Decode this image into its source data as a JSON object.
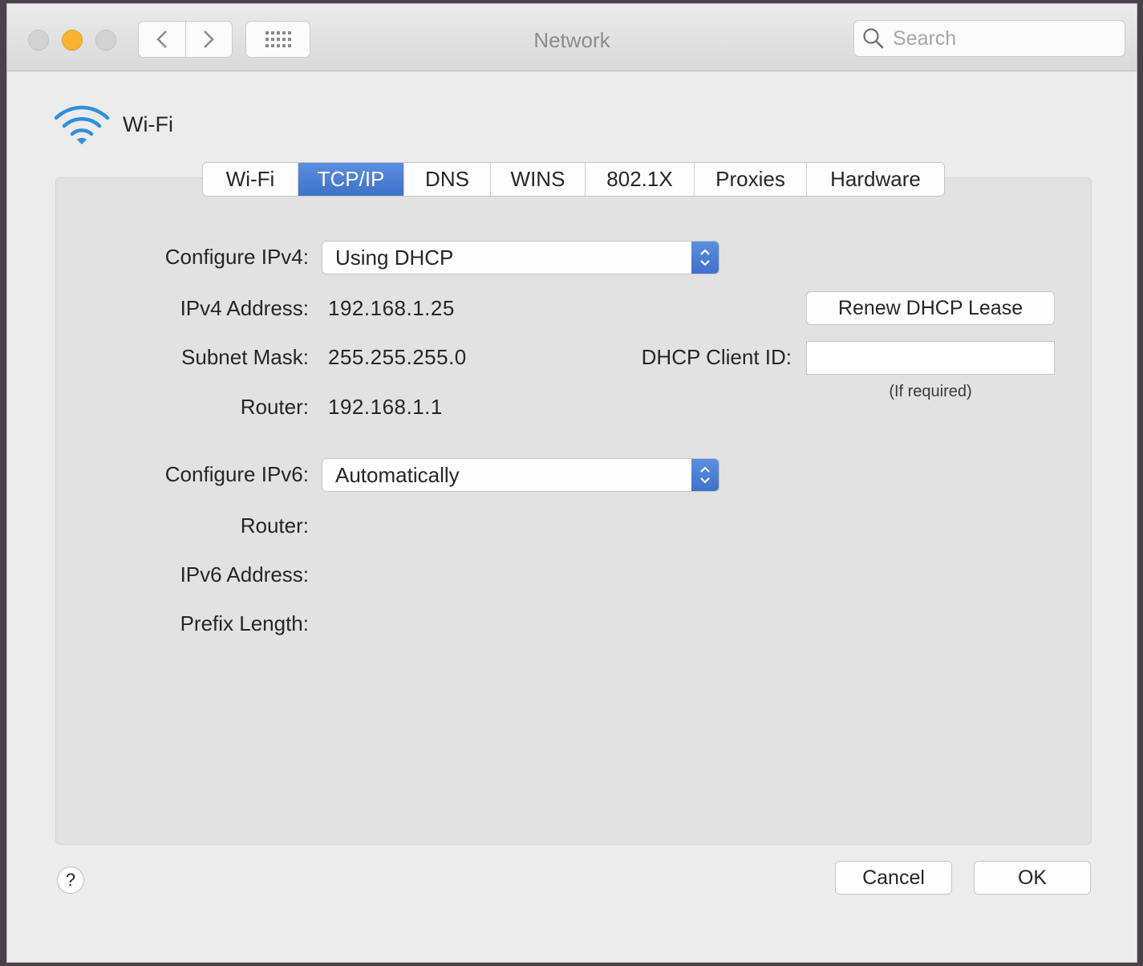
{
  "window": {
    "title": "Network"
  },
  "search": {
    "placeholder": "Search"
  },
  "interface": {
    "name": "Wi-Fi",
    "icon": "wifi-icon"
  },
  "tabs": [
    {
      "label": "Wi-Fi",
      "active": false
    },
    {
      "label": "TCP/IP",
      "active": true
    },
    {
      "label": "DNS",
      "active": false
    },
    {
      "label": "WINS",
      "active": false
    },
    {
      "label": "802.1X",
      "active": false
    },
    {
      "label": "Proxies",
      "active": false
    },
    {
      "label": "Hardware",
      "active": false
    }
  ],
  "ipv4": {
    "configure_label": "Configure IPv4:",
    "configure_value": "Using DHCP",
    "address_label": "IPv4 Address:",
    "address_value": "192.168.1.25",
    "subnet_label": "Subnet Mask:",
    "subnet_value": "255.255.255.0",
    "router_label": "Router:",
    "router_value": "192.168.1.1"
  },
  "dhcp": {
    "renew_label": "Renew DHCP Lease",
    "client_id_label": "DHCP Client ID:",
    "client_id_value": "",
    "client_id_hint": "(If required)"
  },
  "ipv6": {
    "configure_label": "Configure IPv6:",
    "configure_value": "Automatically",
    "router_label": "Router:",
    "address_label": "IPv6 Address:",
    "prefix_label": "Prefix Length:"
  },
  "footer": {
    "help_label": "?",
    "cancel_label": "Cancel",
    "ok_label": "OK"
  },
  "colors": {
    "accent": "#3e71c9",
    "minimize": "#f7b42c",
    "wifi": "#2f8fe0"
  }
}
